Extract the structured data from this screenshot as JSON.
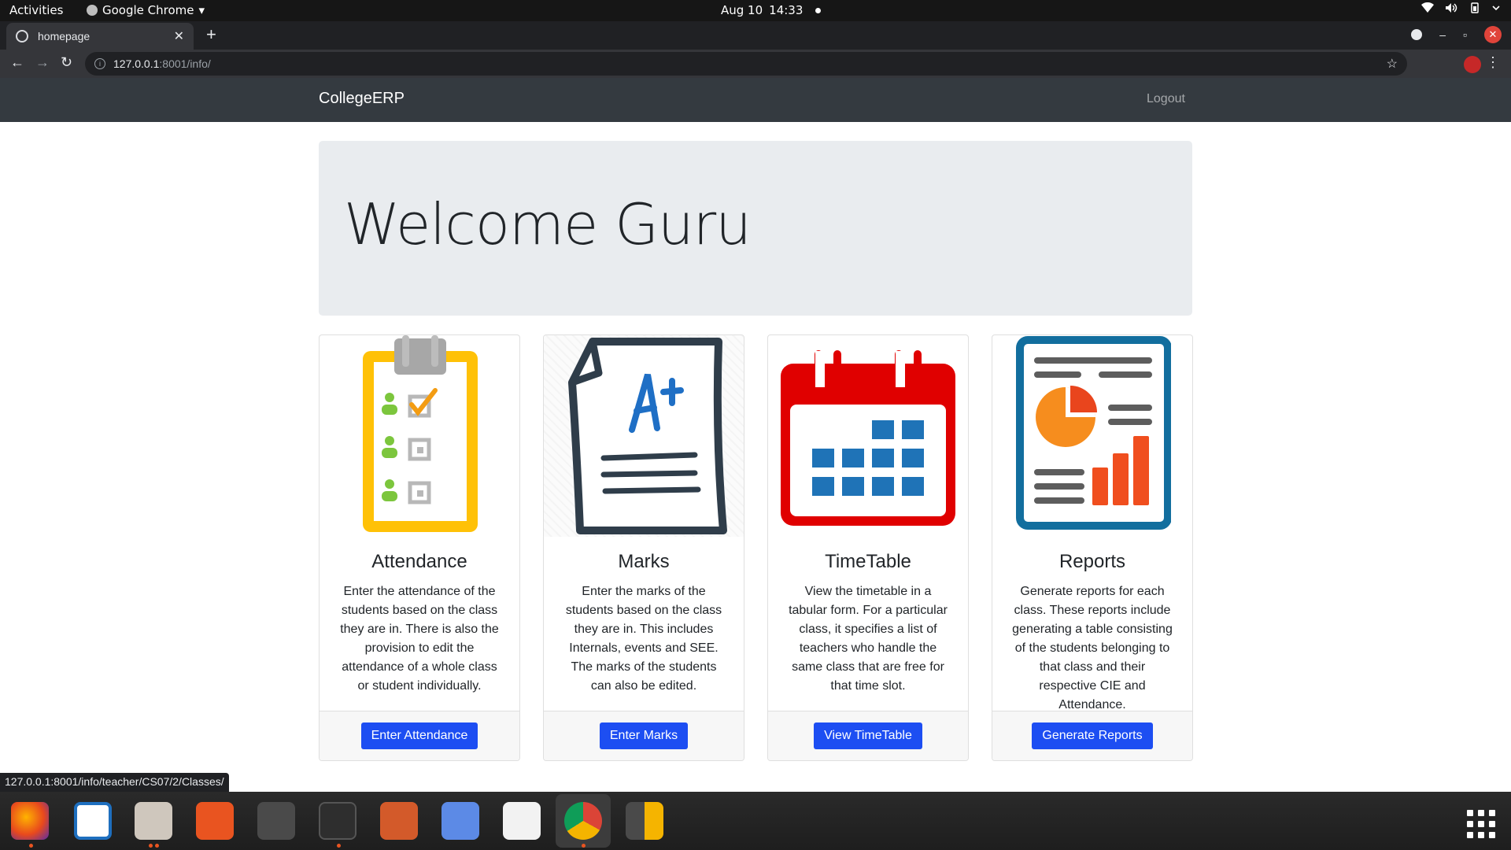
{
  "system_bar": {
    "activities": "Activities",
    "app_name": "Google Chrome",
    "date": "Aug 10",
    "time": "14:33"
  },
  "browser": {
    "tab_title": "homepage",
    "url_host": "127.0.0.1",
    "url_path": ":8001/info/",
    "status_url": "127.0.0.1:8001/info/teacher/CS07/2/Classes/"
  },
  "navbar": {
    "brand": "CollegeERP",
    "logout": "Logout"
  },
  "jumbotron": {
    "heading": "Welcome Guru"
  },
  "cards": [
    {
      "title": "Attendance",
      "text": "Enter the attendance of the students based on the class they are in. There is also the provision to edit the attendance of a whole class or student individually.",
      "button": "Enter Attendance",
      "icon": "clipboard-checklist-icon"
    },
    {
      "title": "Marks",
      "text": "Enter the marks of the students based on the class they are in. This includes Internals, events and SEE. The marks of the students can also be edited.",
      "button": "Enter Marks",
      "icon": "graded-paper-icon"
    },
    {
      "title": "TimeTable",
      "text": "View the timetable in a tabular form. For a particular class, it specifies a list of teachers who handle the same class that are free for that time slot.",
      "button": "View TimeTable",
      "icon": "calendar-icon"
    },
    {
      "title": "Reports",
      "text": "Generate reports for each class. These reports include generating a table consisting of the students belonging to that class and their respective CIE and Attendance.",
      "button": "Generate Reports",
      "icon": "report-chart-icon"
    }
  ],
  "colors": {
    "navbar_bg": "#343a40",
    "jumbotron_bg": "#e9ecef",
    "button_primary": "#1d4ef2"
  },
  "dock": {
    "apps": [
      "firefox-icon",
      "writer-icon",
      "files-icon",
      "software-center-icon",
      "sublime-text-icon",
      "terminal-icon",
      "impress-icon",
      "tasks-icon",
      "text-editor-icon",
      "chrome-icon",
      "calculator-icon",
      "show-apps-icon"
    ]
  }
}
